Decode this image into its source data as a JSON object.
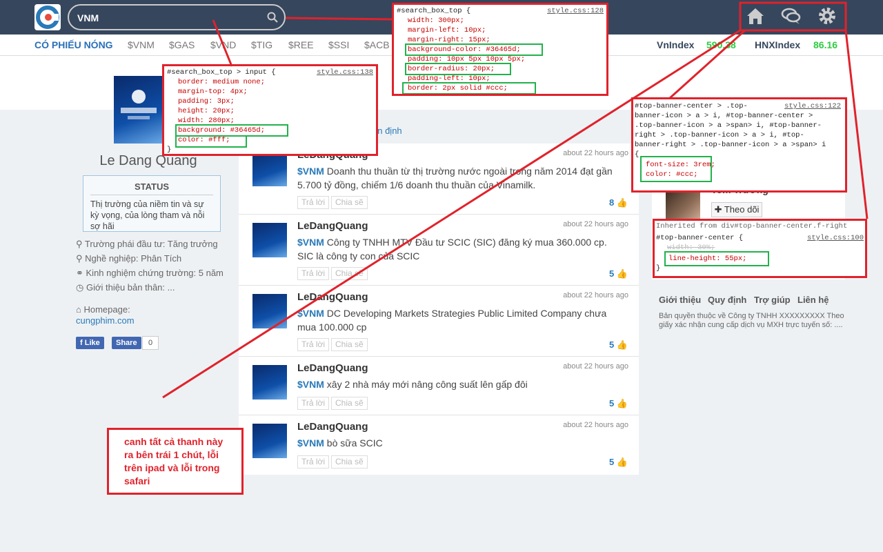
{
  "search": {
    "value": "VNM"
  },
  "ticker": {
    "hot_label": "CÓ PHIẾU NÓNG",
    "symbols": [
      "$VNM",
      "$GAS",
      "$VND",
      "$TIG",
      "$REE",
      "$SSI",
      "$ACB"
    ],
    "vnindex_label": "VnIndex",
    "vnindex_value": "590.38",
    "hnx_label": "HNXIndex",
    "hnx_value": "86.16"
  },
  "profile": {
    "name": "Le Dang Quang",
    "status_title": "STATUS",
    "status_text": "Thị trường của niềm tin và sự kỳ vọng, của lòng tham và nỗi sợ hãi",
    "info": [
      "Trường phái đầu tư: Tăng trưởng",
      "Nghề nghiệp: Phân Tích",
      "Kinh nghiệm chứng trường: 5 năm",
      "Giới thiệu bản thân: ..."
    ],
    "homepage_label": "Homepage:",
    "homepage_link": "cungphim.com",
    "like_label": "Like",
    "share_label": "Share",
    "share_count": "0"
  },
  "feed": {
    "tab_text": "ận định",
    "reply_label": "Trả lời",
    "share_label": "Chia sẽ",
    "posts": [
      {
        "author": "LeDangQuang",
        "time": "about 22 hours ago",
        "tag": "$VNM",
        "text": "Doanh thu thuần từ thị trường nước ngoài trong năm 2014 đạt gần 5.700 tỷ đồng, chiếm 1/6 doanh thu thuần của Vinamilk.",
        "likes": "8"
      },
      {
        "author": "LeDangQuang",
        "time": "about 22 hours ago",
        "tag": "$VNM",
        "text": "Công ty TNHH MTV Đầu tư SCIC (SIC) đăng ký mua 360.000 cp. SIC là công ty con của SCIC",
        "likes": "5"
      },
      {
        "author": "LeDangQuang",
        "time": "about 22 hours ago",
        "tag": "$VNM",
        "text": "DC Developing Markets Strategies Public Limited Company chưa mua 100.000 cp",
        "likes": "5"
      },
      {
        "author": "LeDangQuang",
        "time": "about 22 hours ago",
        "tag": "$VNM",
        "text": "xây 2 nhà máy mới nâng công suất lên gấp đôi",
        "likes": "5"
      },
      {
        "author": "LeDangQuang",
        "time": "about 22 hours ago",
        "tag": "$VNM",
        "text": "bò sữa SCIC",
        "likes": "5"
      }
    ]
  },
  "right": {
    "user_name": "Tom Trương",
    "follow_label": "Theo dõi",
    "footer_links": [
      "Giới thiệu",
      "Quy định",
      "Trợ giúp",
      "Liên hệ"
    ],
    "copyright": "Bản quyền thuộc về Công ty TNHH XXXXXXXXX Theo giấy xác nhận cung cấp dịch vụ MXH trực tuyến số: ...."
  },
  "devtools": {
    "box1": {
      "selector": "#search_box_top {",
      "file": "style.css:128",
      "lines": [
        "width: 300px;",
        "margin-left: 10px;",
        "margin-right: 15px;",
        "background-color: #36465d;",
        "padding: 10px 5px 10px 5px;",
        "border-radius: 20px;",
        "padding-left: 10px;",
        "border: 2px solid #ccc;"
      ]
    },
    "box2": {
      "selector": "#search_box_top > input {",
      "file": "style.css:138",
      "lines": [
        "border: medium none;",
        "margin-top: 4px;",
        "padding: 3px;",
        "height: 20px;",
        "width: 280px;",
        "background: #36465d;",
        "color: #fff;",
        "}"
      ]
    },
    "box3": {
      "file": "style.css:122",
      "lines": [
        "#top-banner-center > .top-",
        "banner-icon > a > i, #top-banner-center >",
        ".top-banner-icon > a >span> i, #top-banner-",
        "right > .top-banner-icon > a > i, #top-",
        "banner-right > .top-banner-icon > a >span> i",
        "{",
        "font-size: 3rem;",
        "color: #ccc;"
      ]
    },
    "box4": {
      "inherited": "Inherited from div#top-banner-center.f-right",
      "selector": "#top-banner-center {",
      "file": "style.css:100",
      "lines": [
        "width: 30%;",
        "line-height: 55px;",
        "}"
      ]
    }
  },
  "note": "canh tất cả thanh này ra bên trái 1 chút, lỗi trên ipad và lỗi trong safari",
  "colors": {
    "topbar": "#36465d",
    "annotation": "#e0222b",
    "highlight": "#22b14c",
    "accent": "#2a7ab8",
    "index_green": "#2ecc40"
  }
}
